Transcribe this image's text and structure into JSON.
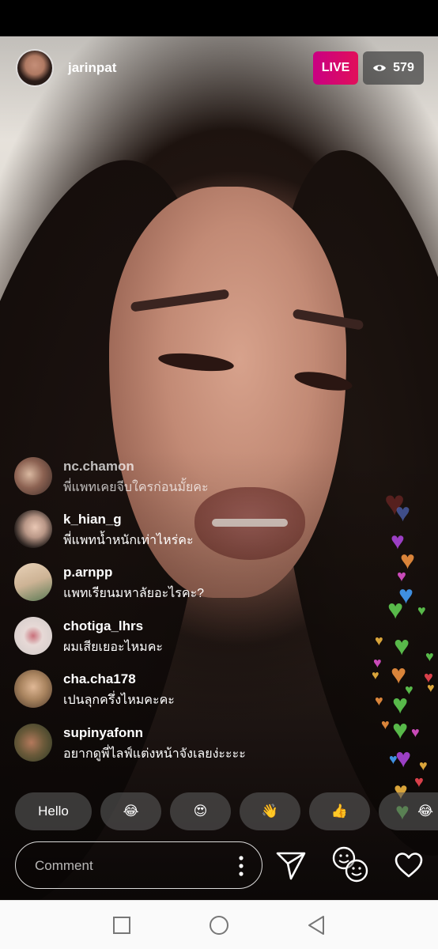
{
  "header": {
    "host_username": "jarinpat",
    "live_label": "LIVE",
    "viewer_count": "579"
  },
  "comments": [
    {
      "username": "nc.chamon",
      "text": "พี่แพทเคยจีบใครก่อนมั้ยคะ"
    },
    {
      "username": "k_hian_g",
      "text": "พี่แพทน้ำหนักเท่าไหร่คะ"
    },
    {
      "username": "p.arnpp",
      "text": "แพทเรียนมหาลัยอะไรคะ?"
    },
    {
      "username": "chotiga_lhrs",
      "text": "ผมเสียเยอะไหมคะ"
    },
    {
      "username": "cha.cha178",
      "text": "เปนลุกครึ่งไหมคะคะ"
    },
    {
      "username": "supinyafonn",
      "text": "อยากดูพี่ไลฟ์แต่งหน้าจังเลยง่ะะะะ"
    }
  ],
  "quick_reactions": [
    "Hello",
    "😂",
    "😍",
    "👋",
    "👍",
    "😂"
  ],
  "composer": {
    "placeholder": "Comment"
  },
  "colors": {
    "live_gradient_start": "#c90083",
    "live_gradient_end": "#e10f5a"
  },
  "icons": {
    "viewers": "eye-icon",
    "more": "more-vertical-icon",
    "send": "paper-plane-icon",
    "faces": "face-effects-icon",
    "like": "heart-icon",
    "nav_recents": "square-icon",
    "nav_home": "circle-icon",
    "nav_back": "triangle-back-icon"
  }
}
